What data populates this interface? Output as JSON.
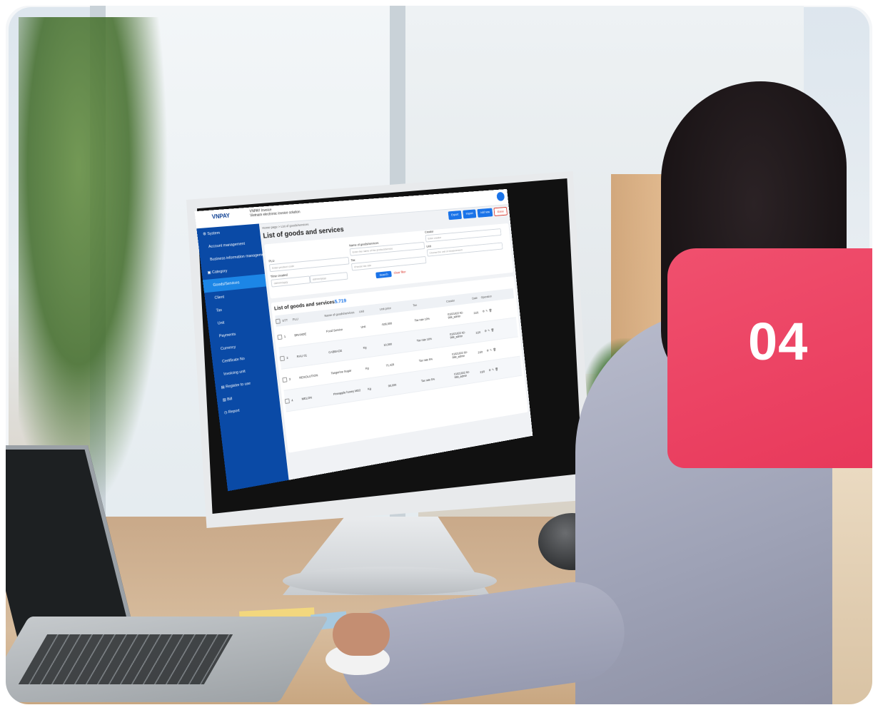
{
  "badge": {
    "number": "04",
    "color": "#ec4060"
  },
  "app": {
    "brand": "VNPAY",
    "product": "VNPAY Invoice",
    "tagline": "Vietnam electronic invoice solution",
    "breadcrumb": "Home page > List of goods/services",
    "page_title": "List of goods and services",
    "toolbar": {
      "export": "Export",
      "import": "Import",
      "add_new": "Add new",
      "erase": "Erase"
    },
    "sidebar": {
      "items": [
        {
          "label": "System",
          "icon": "gear-icon"
        },
        {
          "label": "Account management"
        },
        {
          "label": "Business information management"
        },
        {
          "label": "Category",
          "icon": "folder-icon"
        },
        {
          "label": "Goods/Services",
          "active": true
        },
        {
          "label": "Client"
        },
        {
          "label": "Tax"
        },
        {
          "label": "Unit"
        },
        {
          "label": "Payments"
        },
        {
          "label": "Currency"
        },
        {
          "label": "Certificate No"
        },
        {
          "label": "Invoicing unit"
        },
        {
          "label": "Register to use",
          "icon": "document-icon"
        },
        {
          "label": "Bill",
          "icon": "receipt-icon"
        },
        {
          "label": "Report",
          "icon": "clock-icon"
        }
      ]
    },
    "filters": {
      "plu_label": "PLU",
      "plu_placeholder": "Enter product code",
      "name_label": "Name of goods/services",
      "name_placeholder": "Enter the name of the product/service",
      "creator_label": "Creator",
      "creator_placeholder": "Enter creator",
      "time_label": "Time created",
      "date_from": "dd/mm/yyyy",
      "date_to": "dd/mm/yyyy",
      "tax_label": "Tax",
      "tax_placeholder": "Choose tax rate",
      "unit_label": "Unit",
      "unit_placeholder": "Choose the unit of measurement",
      "search": "Search",
      "clear": "Clear filter"
    },
    "list": {
      "title": "List of goods and services",
      "count": "5.719",
      "columns": [
        "STT",
        "PLU",
        "Name of goods/services",
        "Unit",
        "Unit price",
        "Tax",
        "Creator",
        "Date",
        "Operation"
      ],
      "rows": [
        {
          "stt": "1",
          "plu": "BRANDE",
          "name": "Food Service",
          "unit": "Unit",
          "price": "-536,000",
          "tax": "Tax rate 10%",
          "creator": "01021022 92-999_admin",
          "date": "21/0"
        },
        {
          "stt": "2",
          "plu": "RAU 01",
          "name": "CABBAGE",
          "unit": "Kg",
          "price": "10,000",
          "tax": "Tax rate 10%",
          "creator": "01021022 92-999_admin",
          "date": "21/0"
        },
        {
          "stt": "3",
          "plu": "RESOLUTION",
          "name": "Tangerine Sugar",
          "unit": "Kg",
          "price": "71,429",
          "tax": "Tax rate 5%",
          "creator": "01021022 92-999_admin",
          "date": "21/0"
        },
        {
          "stt": "4",
          "plu": "MELON",
          "name": "Pineapple honey MD2",
          "unit": "Kg",
          "price": "90,000",
          "tax": "Tax rate 5%",
          "creator": "01021022 92-999_admin",
          "date": "21/0"
        }
      ]
    }
  }
}
